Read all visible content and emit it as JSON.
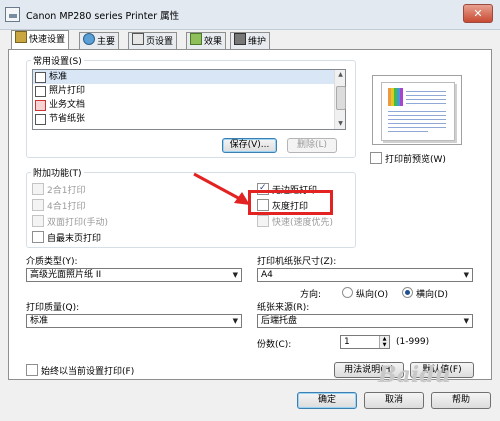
{
  "window": {
    "title": "Canon MP280 series Printer 属性",
    "close_glyph": "✕"
  },
  "tabs": [
    {
      "label": "快速设置",
      "icon": "quick-setup-icon"
    },
    {
      "label": "主要",
      "icon": "main-icon"
    },
    {
      "label": "页设置",
      "icon": "page-setup-icon"
    },
    {
      "label": "效果",
      "icon": "effects-icon"
    },
    {
      "label": "维护",
      "icon": "maintenance-icon"
    }
  ],
  "common_settings": {
    "label": "常用设置(S)",
    "items": [
      "标准",
      "照片打印",
      "业务文档",
      "节省纸张"
    ],
    "save_button": "保存(V)...",
    "delete_button": "删除(L)"
  },
  "print_preview_label": "打印前预览(W)",
  "additional_features": {
    "label": "附加功能(T)",
    "left": [
      {
        "label": "2合1打印",
        "checked": false,
        "disabled": true
      },
      {
        "label": "4合1打印",
        "checked": false,
        "disabled": true
      },
      {
        "label": "双面打印(手动)",
        "checked": false,
        "disabled": true
      },
      {
        "label": "自最末页打印",
        "checked": false,
        "disabled": false
      }
    ],
    "right": [
      {
        "label": "无边距打印",
        "checked": true,
        "disabled": false
      },
      {
        "label": "灰度打印",
        "checked": false,
        "disabled": false
      },
      {
        "label": "快速(速度优先)",
        "checked": false,
        "disabled": true
      }
    ]
  },
  "media_type": {
    "label": "介质类型(Y):",
    "value": "高级光面照片纸 II"
  },
  "paper_size": {
    "label": "打印机纸张尺寸(Z):",
    "value": "A4"
  },
  "orientation": {
    "label": "方向:",
    "portrait": "纵向(O)",
    "landscape": "横向(D)",
    "selected": "landscape"
  },
  "print_quality": {
    "label": "打印质量(Q):",
    "value": "标准"
  },
  "paper_source": {
    "label": "纸张来源(R):",
    "value": "后端托盘"
  },
  "copies": {
    "label": "份数(C):",
    "value": "1",
    "range": "(1-999)"
  },
  "always_print_current": "始终以当前设置打印(F)",
  "instructions_button": "用法说明(H)",
  "defaults_button": "默认值(F)",
  "dialog_buttons": {
    "ok": "确定",
    "cancel": "取消",
    "help": "帮助"
  },
  "watermark_text": "Baidu",
  "colors": {
    "highlight": "#e32222",
    "arrow": "#e32222",
    "accent": "#1d4f91"
  }
}
